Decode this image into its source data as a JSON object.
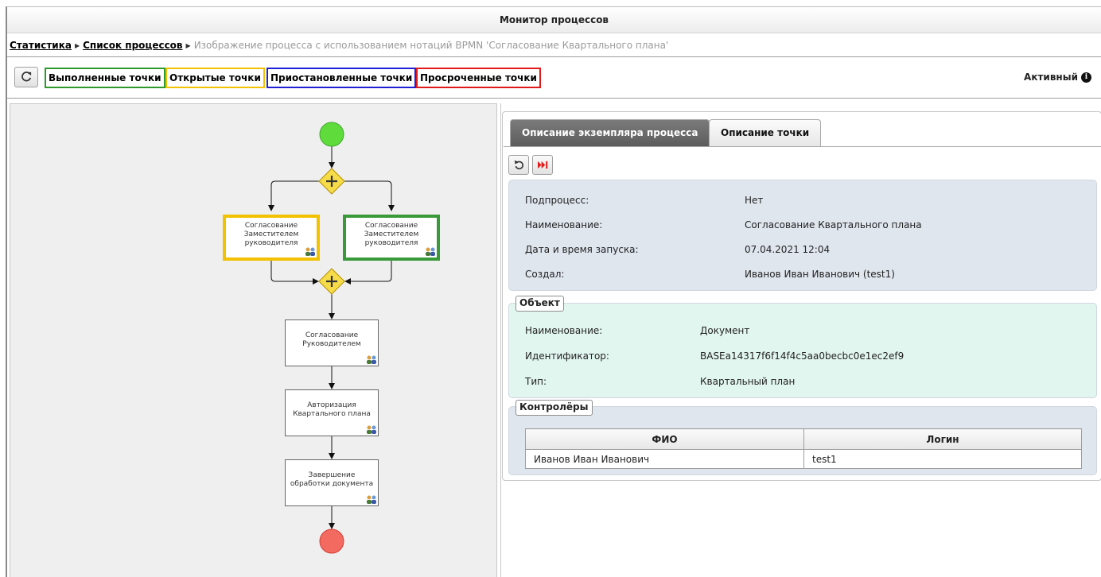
{
  "window": {
    "title": "Монитор процессов"
  },
  "breadcrumb": {
    "items": [
      "Статистика",
      "Список процессов"
    ],
    "current": "Изображение процесса с использованием нотаций BPMN 'Согласование Квартального плана'"
  },
  "toolbar": {
    "refresh_icon": "refresh-icon",
    "legend": [
      {
        "label": "Выполненные точки",
        "color": "#2e9a2e"
      },
      {
        "label": "Открытые точки",
        "color": "#f2c200"
      },
      {
        "label": "Приостановленные точки",
        "color": "#1f1fd6"
      },
      {
        "label": "Просроченные точки",
        "color": "#e01919"
      }
    ],
    "status": "Активный"
  },
  "diagram": {
    "start_color": "#5fdc3c",
    "end_color": "#f26a60",
    "gateway_color": "#f7dc49",
    "tasks": [
      {
        "label": "Согласование Заместителем руководителя",
        "state": "open"
      },
      {
        "label": "Согласование Заместителем руководителя",
        "state": "done"
      },
      {
        "label": "Согласование Руководителем",
        "state": "none"
      },
      {
        "label": "Авторизация Квартального плана",
        "state": "none"
      },
      {
        "label": "Завершение обработки документа",
        "state": "none"
      }
    ]
  },
  "tabs": [
    "Описание экземпляра процесса",
    "Описание точки"
  ],
  "process": {
    "rows": [
      {
        "label": "Подпроцесс:",
        "value": "Нет"
      },
      {
        "label": "Наименование:",
        "value": "Согласование Квартального плана"
      },
      {
        "label": "Дата и время запуска:",
        "value": "07.04.2021 12:04"
      },
      {
        "label": "Создал:",
        "value": "Иванов Иван Иванович (test1)"
      }
    ]
  },
  "object": {
    "title": "Объект",
    "rows": [
      {
        "label": "Наименование:",
        "value": "Документ"
      },
      {
        "label": "Идентификатор:",
        "value": "BASEa14317f6f14f4c5aa0becbc0e1ec2ef9"
      },
      {
        "label": "Тип:",
        "value": "Квартальный план"
      }
    ]
  },
  "controllers": {
    "title": "Контролёры",
    "columns": [
      "ФИО",
      "Логин"
    ],
    "rows": [
      [
        "Иванов Иван Иванович",
        "test1"
      ]
    ]
  }
}
